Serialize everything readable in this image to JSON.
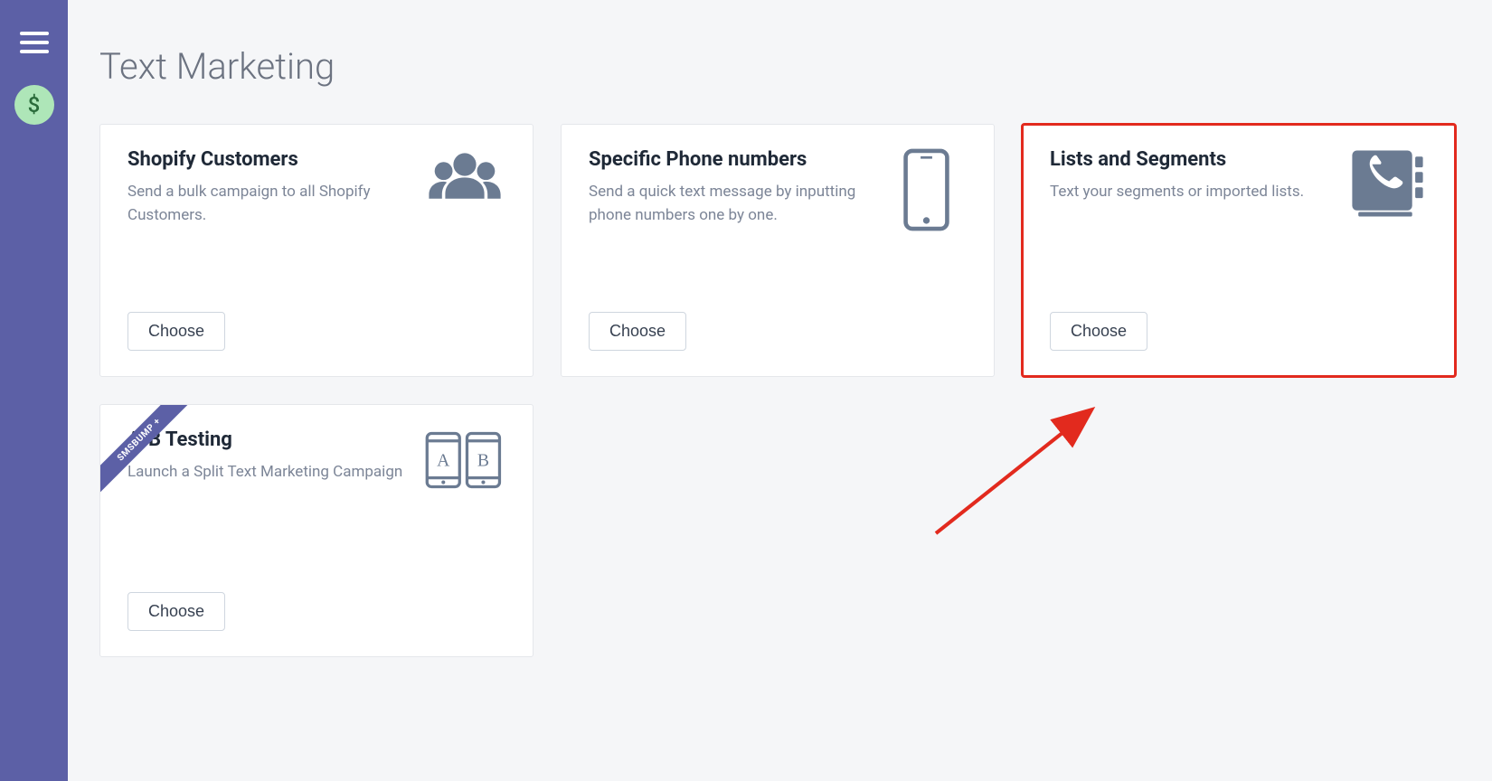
{
  "page": {
    "title": "Text Marketing"
  },
  "sidebar": {
    "dollar_label": "$"
  },
  "cards": [
    {
      "title": "Shopify Customers",
      "description": "Send a bulk campaign to all Shopify Customers.",
      "button": "Choose"
    },
    {
      "title": "Specific Phone numbers",
      "description": "Send a quick text message by inputting phone numbers one by one.",
      "button": "Choose"
    },
    {
      "title": "Lists and Segments",
      "description": "Text your segments or imported lists.",
      "button": "Choose"
    },
    {
      "ribbon": "SMSBUMP +",
      "title": "A/B Testing",
      "description": "Launch a Split Text Marketing Campaign",
      "button": "Choose"
    }
  ]
}
